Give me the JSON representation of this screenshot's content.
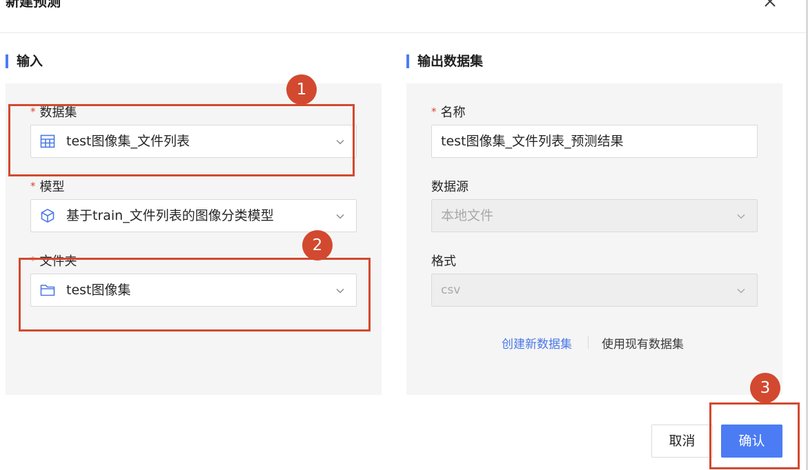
{
  "dialog": {
    "title": "新建预测"
  },
  "input": {
    "section_title": "输入",
    "dataset": {
      "label": "数据集",
      "required": "*",
      "value": "test图像集_文件列表"
    },
    "model": {
      "label": "模型",
      "required": "*",
      "value": "基于train_文件列表的图像分类模型"
    },
    "folder": {
      "label": "文件夹",
      "required": "*",
      "value": "test图像集"
    }
  },
  "output": {
    "section_title": "输出数据集",
    "name": {
      "label": "名称",
      "required": "*",
      "value": "test图像集_文件列表_预测结果"
    },
    "source": {
      "label": "数据源",
      "value": "本地文件"
    },
    "format": {
      "label": "格式",
      "value": "csv"
    },
    "create_new_link": "创建新数据集",
    "use_existing_link": "使用现有数据集"
  },
  "footer": {
    "cancel_label": "取消",
    "confirm_label": "确认"
  },
  "annotations": [
    "1",
    "2",
    "3"
  ],
  "colors": {
    "accent": "#4c7cf3",
    "annotation": "#d2492f",
    "link": "#4a78e8"
  }
}
